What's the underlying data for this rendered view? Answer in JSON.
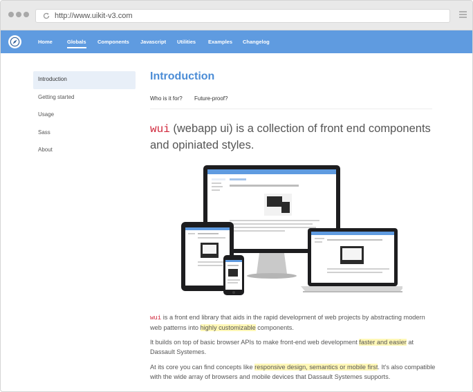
{
  "browser": {
    "url": "http://www.uikit-v3.com"
  },
  "nav": {
    "items": [
      {
        "label": "Home"
      },
      {
        "label": "Globals"
      },
      {
        "label": "Components"
      },
      {
        "label": "Javascript"
      },
      {
        "label": "Utilities"
      },
      {
        "label": "Examples"
      },
      {
        "label": "Changelog"
      }
    ],
    "active": "Globals"
  },
  "sidebar": {
    "items": [
      {
        "label": "Introduction"
      },
      {
        "label": "Getting started"
      },
      {
        "label": "Usage"
      },
      {
        "label": "Sass"
      },
      {
        "label": "About"
      }
    ],
    "active": "Introduction"
  },
  "main": {
    "title": "Introduction",
    "subnav": [
      {
        "label": "Who is it for?"
      },
      {
        "label": "Future-proof?"
      }
    ],
    "lead": {
      "code": "wui",
      "text": " (webapp ui) is a collection of front end components and opiniated styles."
    },
    "paragraphs": [
      {
        "code": "wui",
        "before": " is a front end library that aids in the rapid development of web projects by abstracting modern web patterns into ",
        "highlight": "highly customizable",
        "after": " components."
      },
      {
        "before": "It builds on top of basic browser APIs to make front-end web development ",
        "highlight": "faster and easier",
        "after": " at Dassault Systemes."
      },
      {
        "before": "At its core you can find concepts like ",
        "highlight": "responsive design, semantics or mobile first",
        "after": ". It's also compatible with the wide array of browsers and mobile devices that Dassault Systemes supports."
      }
    ]
  },
  "colors": {
    "accent": "#5f9be0",
    "title": "#4c8dd6",
    "code": "#d0283c",
    "highlight": "#fff7b6",
    "sidebar_active_bg": "#e8eff8"
  }
}
